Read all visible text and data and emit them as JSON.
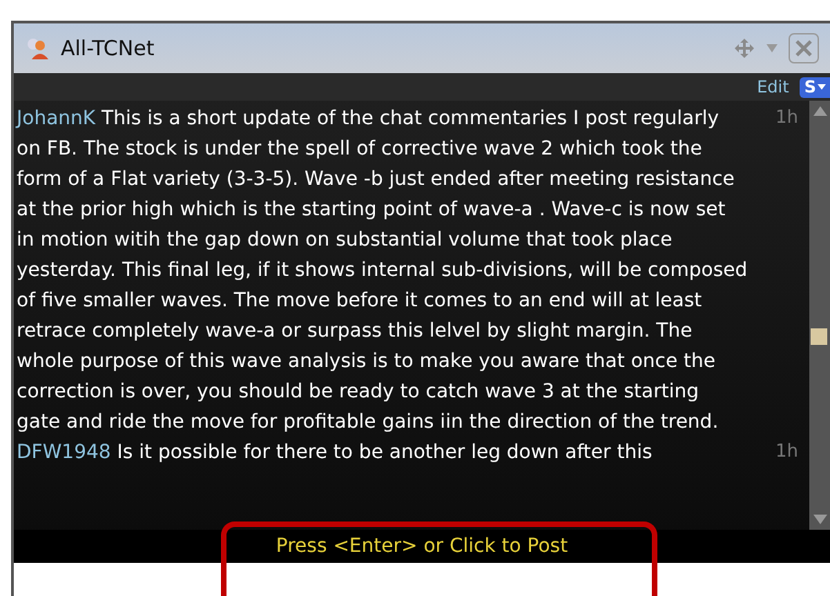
{
  "window": {
    "title": "All-TCNet"
  },
  "toolbar": {
    "edit": "Edit",
    "s_button": "S"
  },
  "messages": [
    {
      "author": "JohannK",
      "text": "This is a short update of the chat commentaries I post regularly on FB. The stock is under the spell of corrective wave 2 which took the form of a Flat variety (3-3-5).  Wave -b just ended after meeting resistance at the prior high which is the starting point of wave-a . Wave-c is now set in motion witih the gap down on substantial volume that took place yesterday. This final leg, if it shows internal sub-divisions, will be composed of five smaller waves. The move before it comes to an end will at least retrace completely wave-a or surpass this lelvel by slight margin. The whole purpose of this wave analysis is to make you aware that once the correction is over, you should be ready to catch wave 3 at the starting gate and ride the move for profitable gains iin the direction of the trend.",
      "time": "1h"
    },
    {
      "author": "DFW1948",
      "text": "Is it possible for there to be another leg down after this",
      "time": "1h"
    }
  ],
  "post_hint": "Press <Enter> or Click to Post"
}
